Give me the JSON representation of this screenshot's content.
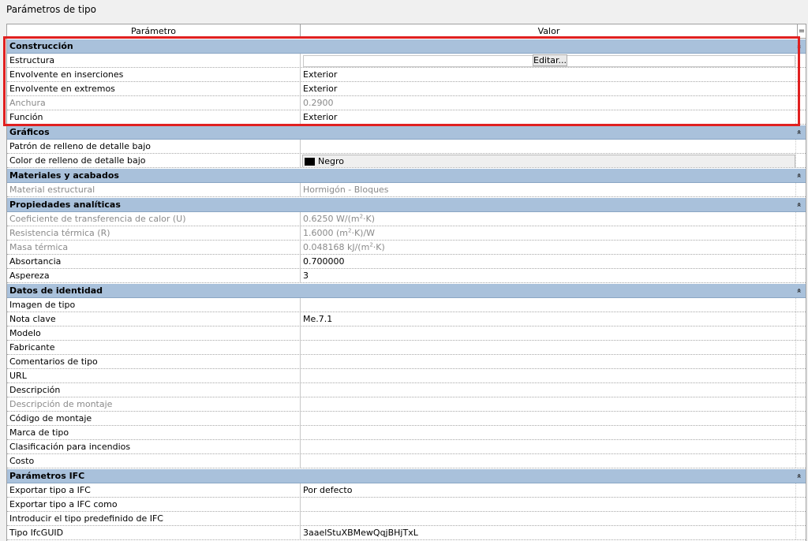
{
  "dialog_title": "Parámetros de tipo",
  "columns": {
    "parametro": "Parámetro",
    "valor": "Valor",
    "extra": "="
  },
  "groups": {
    "construccion": {
      "title": "Construcción",
      "rows": [
        {
          "param": "Estructura",
          "value": "Editar..."
        },
        {
          "param": "Envolvente en inserciones",
          "value": "Exterior"
        },
        {
          "param": "Envolvente en extremos",
          "value": "Exterior"
        },
        {
          "param": "Anchura",
          "value": "0.2900"
        },
        {
          "param": "Función",
          "value": "Exterior"
        }
      ]
    },
    "graficos": {
      "title": "Gráficos",
      "rows": [
        {
          "param": "Patrón de relleno de detalle bajo",
          "value": ""
        },
        {
          "param": "Color de relleno de detalle bajo",
          "value": "Negro"
        }
      ]
    },
    "materiales": {
      "title": "Materiales y acabados",
      "rows": [
        {
          "param": "Material estructural",
          "value": "Hormigón  - Bloques"
        }
      ]
    },
    "analiticas": {
      "title": "Propiedades analíticas",
      "rows": [
        {
          "param": "Coeficiente de transferencia de calor (U)",
          "value_a": "0.6250 W/(m",
          "value_sup": "2",
          "value_b": "·K)"
        },
        {
          "param": "Resistencia térmica (R)",
          "value_a": "1.6000 (m",
          "value_sup": "2",
          "value_b": "·K)/W"
        },
        {
          "param": "Masa térmica",
          "value_a": "0.048168 kJ/(m",
          "value_sup": "2",
          "value_b": "·K)"
        },
        {
          "param": "Absortancia",
          "value": "0.700000"
        },
        {
          "param": "Aspereza",
          "value": "3"
        }
      ]
    },
    "identidad": {
      "title": "Datos de identidad",
      "rows": [
        {
          "param": "Imagen de tipo",
          "value": ""
        },
        {
          "param": "Nota clave",
          "value": "Me.7.1"
        },
        {
          "param": "Modelo",
          "value": ""
        },
        {
          "param": "Fabricante",
          "value": ""
        },
        {
          "param": "Comentarios de tipo",
          "value": ""
        },
        {
          "param": "URL",
          "value": ""
        },
        {
          "param": "Descripción",
          "value": ""
        },
        {
          "param": "Descripción de montaje",
          "value": ""
        },
        {
          "param": "Código de montaje",
          "value": ""
        },
        {
          "param": "Marca de tipo",
          "value": ""
        },
        {
          "param": "Clasificación para incendios",
          "value": ""
        },
        {
          "param": "Costo",
          "value": ""
        }
      ]
    },
    "ifc": {
      "title": "Parámetros IFC",
      "rows": [
        {
          "param": "Exportar tipo a IFC",
          "value": "Por defecto"
        },
        {
          "param": "Exportar tipo a IFC como",
          "value": ""
        },
        {
          "param": "Introducir el tipo predefinido de IFC",
          "value": ""
        },
        {
          "param": "Tipo IfcGUID",
          "value": "3aaelStuXBMewQqjBHjTxL"
        }
      ]
    }
  },
  "collapse_glyph": "»",
  "highlight_color": "#e02020",
  "group_color": "#a9c1db",
  "disabled_text_color": "#8a8a8a"
}
